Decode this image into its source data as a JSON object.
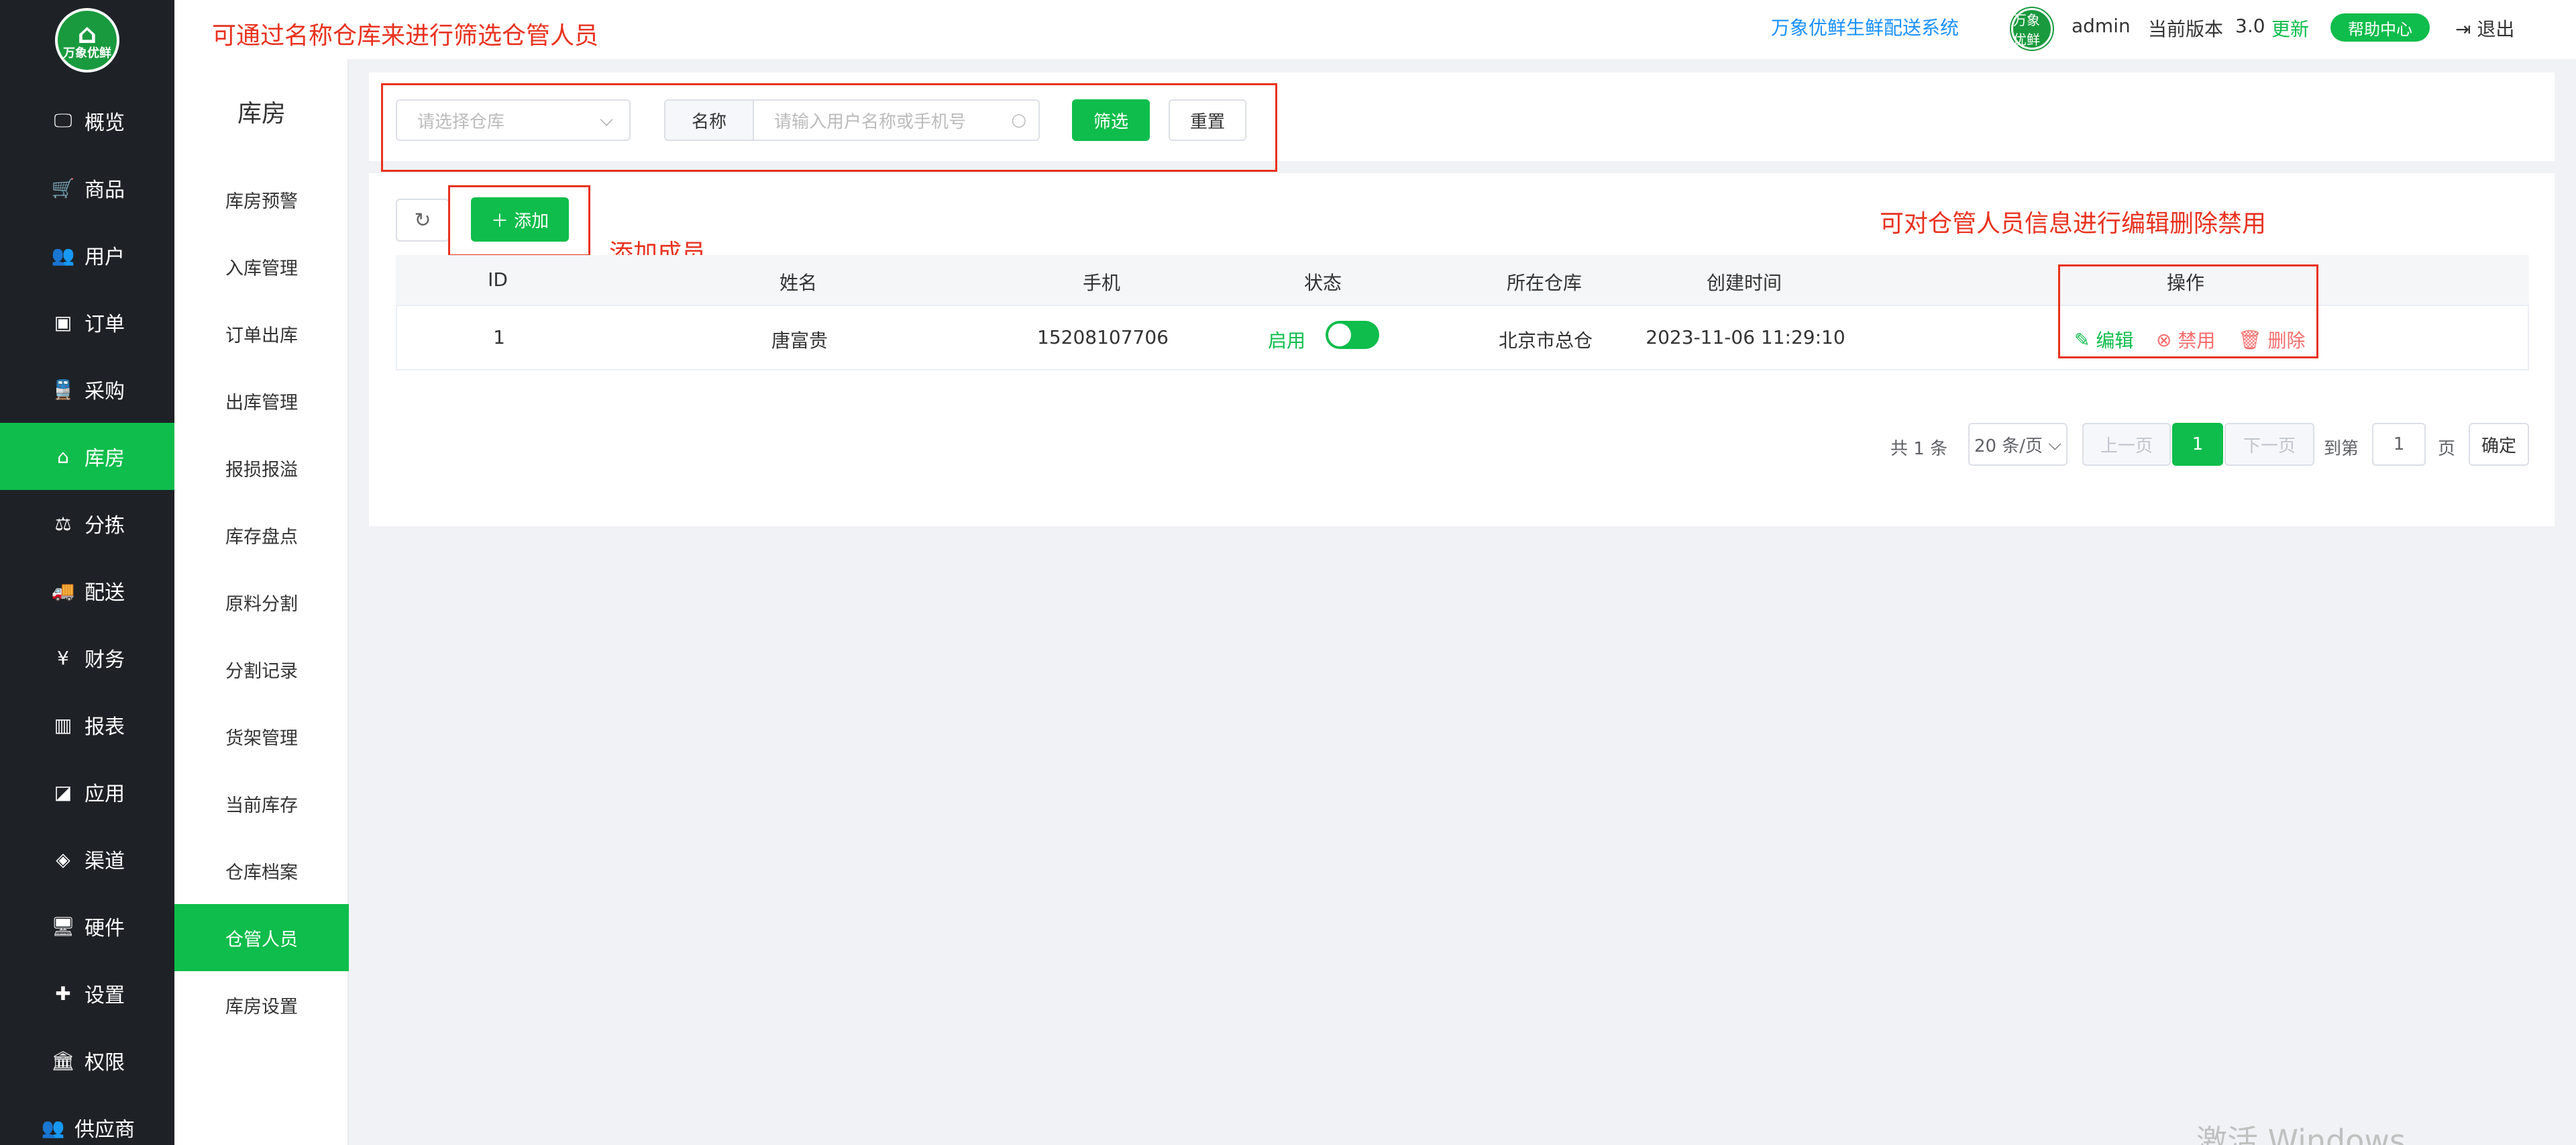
{
  "header": {
    "annotation_filter": "可通过名称仓库来进行筛选仓管人员",
    "system_name": "万象优鲜生鲜配送系统",
    "avatar_text": "万象优鲜",
    "username": "admin",
    "version_label": "当前版本",
    "version_value": "3.0",
    "update_label": "更新",
    "help_label": "帮助中心",
    "logout_label": "退出"
  },
  "logo_text": "万象优鲜",
  "sidebar": {
    "items": [
      {
        "label": "概览",
        "icon": "monitor-icon"
      },
      {
        "label": "商品",
        "icon": "cart-icon"
      },
      {
        "label": "用户",
        "icon": "users-icon"
      },
      {
        "label": "订单",
        "icon": "money-icon"
      },
      {
        "label": "采购",
        "icon": "train-icon"
      },
      {
        "label": "库房",
        "icon": "home-icon"
      },
      {
        "label": "分拣",
        "icon": "scale-icon"
      },
      {
        "label": "配送",
        "icon": "truck-icon"
      },
      {
        "label": "财务",
        "icon": "yen-icon"
      },
      {
        "label": "报表",
        "icon": "bar-chart-icon"
      },
      {
        "label": "应用",
        "icon": "apps-icon"
      },
      {
        "label": "渠道",
        "icon": "cube-icon"
      },
      {
        "label": "硬件",
        "icon": "desktop-icon"
      },
      {
        "label": "设置",
        "icon": "puzzle-icon"
      },
      {
        "label": "权限",
        "icon": "bank-icon"
      },
      {
        "label": "供应商",
        "icon": "group-icon"
      }
    ],
    "active": "库房"
  },
  "subnav": {
    "title": "库房",
    "items": [
      "库房预警",
      "入库管理",
      "订单出库",
      "出库管理",
      "报损报溢",
      "库存盘点",
      "原料分割",
      "分割记录",
      "货架管理",
      "当前库存",
      "仓库档案",
      "仓管人员",
      "库房设置"
    ],
    "active": "仓管人员"
  },
  "filter": {
    "warehouse_placeholder": "请选择仓库",
    "name_label": "名称",
    "name_placeholder": "请输入用户名称或手机号",
    "filter_button": "筛选",
    "reset_button": "重置"
  },
  "toolbar": {
    "add_button": "添加",
    "annotation_add": "添加成员",
    "annotation_ops": "可对仓管人员信息进行编辑删除禁用"
  },
  "table": {
    "columns": [
      "ID",
      "姓名",
      "手机",
      "状态",
      "所在仓库",
      "创建时间",
      "操作"
    ],
    "rows": [
      {
        "id": "1",
        "name": "唐富贵",
        "phone": "15208107706",
        "status": "启用",
        "enabled": true,
        "warehouse": "北京市总仓",
        "created": "2023-11-06 11:29:10",
        "actions": {
          "edit": "编辑",
          "disable": "禁用",
          "delete": "删除"
        }
      }
    ]
  },
  "pagination": {
    "total": "共 1 条",
    "page_size": "20 条/页",
    "prev": "上一页",
    "current": "1",
    "next": "下一页",
    "goto_label": "到第",
    "goto_value": "1",
    "page_unit": "页",
    "confirm": "确定"
  },
  "watermark": "激活 Windows",
  "colors": {
    "primary": "#0ebd4b",
    "sidebar_bg": "#1e2227",
    "annotation": "#e8321f",
    "link_blue": "#1890ff",
    "danger": "#f56c6c"
  }
}
